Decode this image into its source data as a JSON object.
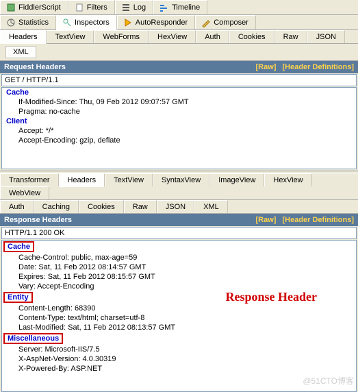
{
  "topTabs": [
    {
      "label": "FiddlerScript",
      "icon": "script"
    },
    {
      "label": "Filters",
      "icon": "filters"
    },
    {
      "label": "Log",
      "icon": "log"
    },
    {
      "label": "Timeline",
      "icon": "timeline"
    },
    {
      "label": "Statistics",
      "icon": "statistics"
    },
    {
      "label": "Inspectors",
      "icon": "inspectors",
      "active": true
    },
    {
      "label": "AutoResponder",
      "icon": "autoresponder"
    },
    {
      "label": "Composer",
      "icon": "composer"
    }
  ],
  "reqSubTabs": [
    "Headers",
    "TextView",
    "WebForms",
    "HexView",
    "Auth",
    "Cookies",
    "Raw",
    "JSON",
    "XML"
  ],
  "reqSubActive": "Headers",
  "reqXmlTab": "XML",
  "reqSection": {
    "title": "Request Headers",
    "raw": "[Raw]",
    "defs": "[Header Definitions]"
  },
  "requestLine": "GET / HTTP/1.1",
  "reqGroups": [
    {
      "name": "Cache",
      "items": [
        "If-Modified-Since: Thu, 09 Feb 2012 09:07:57 GMT",
        "Pragma: no-cache"
      ]
    },
    {
      "name": "Client",
      "items": [
        "Accept: */*",
        "Accept-Encoding: gzip, deflate"
      ]
    }
  ],
  "resSubTabsRow1": [
    "Transformer",
    "Headers",
    "TextView",
    "SyntaxView",
    "ImageView",
    "HexView",
    "WebView"
  ],
  "resSubTabsRow2": [
    "Auth",
    "Caching",
    "Cookies",
    "Raw",
    "JSON",
    "XML"
  ],
  "resSubActive": "Headers",
  "resSection": {
    "title": "Response Headers",
    "raw": "[Raw]",
    "defs": "[Header Definitions]"
  },
  "responseLine": "HTTP/1.1 200 OK",
  "resGroups": [
    {
      "name": "Cache",
      "items": [
        "Cache-Control: public, max-age=59",
        "Date: Sat, 11 Feb 2012 08:14:57 GMT",
        "Expires: Sat, 11 Feb 2012 08:15:57 GMT",
        "Vary: Accept-Encoding"
      ]
    },
    {
      "name": "Entity",
      "items": [
        "Content-Length: 68390",
        "Content-Type: text/html; charset=utf-8",
        "Last-Modified: Sat, 11 Feb 2012 08:13:57 GMT"
      ]
    },
    {
      "name": "Miscellaneous",
      "items": [
        "Server: Microsoft-IIS/7.5",
        "X-AspNet-Version: 4.0.30319",
        "X-Powered-By: ASP.NET"
      ]
    }
  ],
  "annotation": "Response Header",
  "watermark": "@51CTO博客"
}
